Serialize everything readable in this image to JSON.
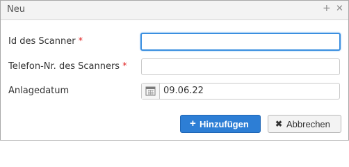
{
  "dialog": {
    "title": "Neu",
    "title_icons": [
      "plus-icon",
      "close-icon"
    ]
  },
  "form": {
    "fields": [
      {
        "label": "Id des Scanner",
        "required": true,
        "required_marker": "*",
        "value": "",
        "focused": true
      },
      {
        "label": "Telefon-Nr. des Scanners",
        "required": true,
        "required_marker": "*",
        "value": ""
      },
      {
        "label": "Anlagedatum",
        "required": false,
        "value": "09.06.22",
        "icon": "calendar-icon"
      }
    ]
  },
  "buttons": {
    "add_label": "Hinzufügen",
    "add_icon": "plus-icon",
    "cancel_label": "Abbrechen",
    "cancel_icon": "close-icon"
  },
  "colors": {
    "accent": "#2d7ed5",
    "focus": "#3b8fe0",
    "required": "#e02424"
  }
}
